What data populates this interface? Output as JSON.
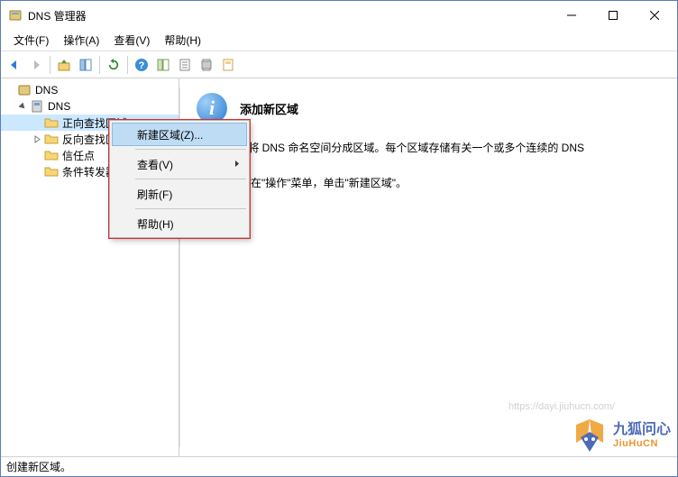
{
  "window": {
    "title": "DNS 管理器"
  },
  "menubar": {
    "file": "文件(F)",
    "action": "操作(A)",
    "view": "查看(V)",
    "help": "帮助(H)"
  },
  "tree": {
    "root": "DNS",
    "server": "DNS",
    "forward": "正向查找区域",
    "reverse": "反向查找区域",
    "trust": "信任点",
    "cond": "条件转发器"
  },
  "context_menu": {
    "new_zone": "新建区域(Z)...",
    "view": "查看(V)",
    "refresh": "刷新(F)",
    "help": "帮助(H)"
  },
  "content": {
    "title": "添加新区域",
    "p1": "(DNS)允许将 DNS 命名空间分成区域。每个区域存储有关一个或多个连续的 DNS",
    "p2": "新区域，请在\"操作\"菜单，单击\"新建区域\"。"
  },
  "statusbar": {
    "text": "创建新区域。"
  },
  "watermark": {
    "line1": "九狐问心",
    "line2": "JiuHuCN",
    "url": "https://dayi.jiuhucn.com/"
  }
}
